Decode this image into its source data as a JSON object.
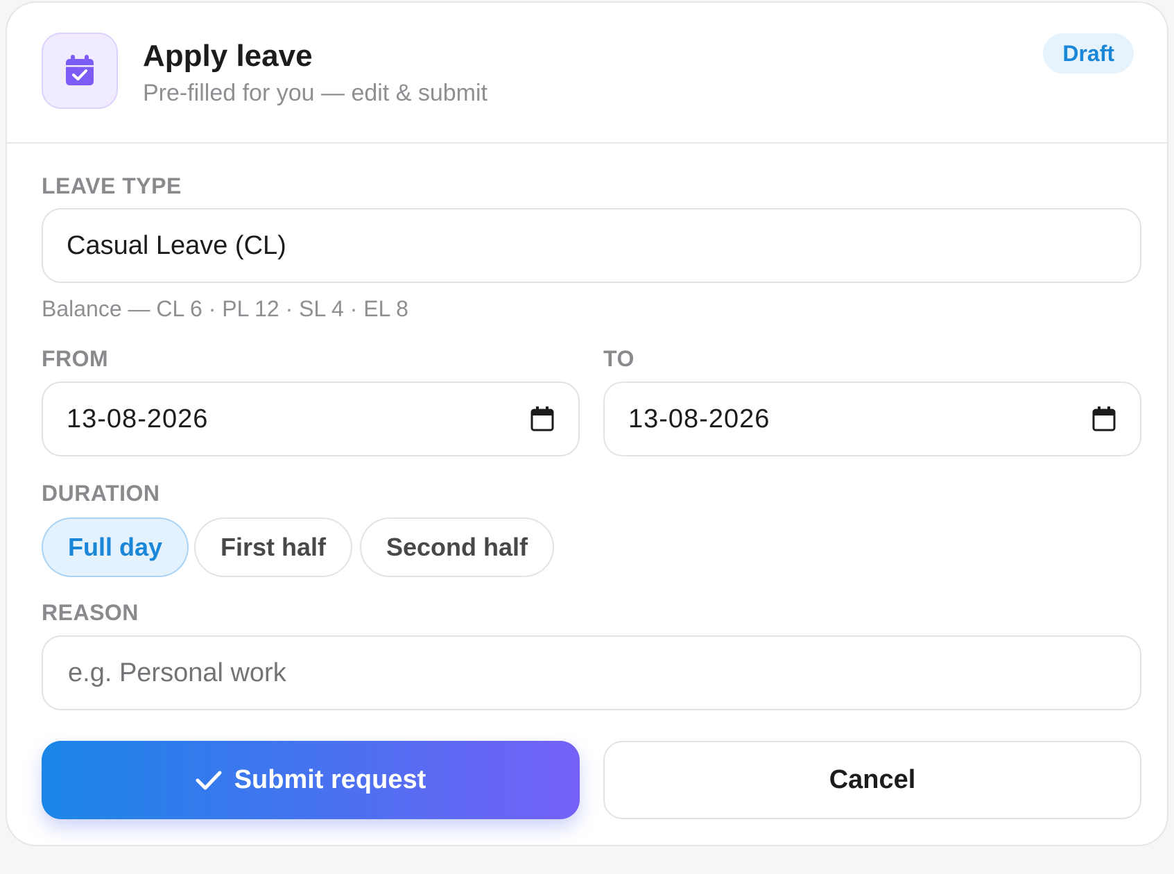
{
  "header": {
    "title": "Apply leave",
    "subtitle": "Pre-filled for you — edit & submit",
    "status_badge": "Draft",
    "icon": "calendar-check-icon"
  },
  "form": {
    "leave_type": {
      "label": "LEAVE TYPE",
      "value": "Casual Leave (CL)",
      "balance_hint": "Balance — CL 6 · PL 12 · SL 4 · EL 8"
    },
    "from": {
      "label": "FROM",
      "value": "13-08-2026",
      "icon": "calendar-icon"
    },
    "to": {
      "label": "TO",
      "value": "13-08-2026",
      "icon": "calendar-icon"
    },
    "duration": {
      "label": "DURATION",
      "options": [
        "Full day",
        "First half",
        "Second half"
      ],
      "selected": "Full day"
    },
    "reason": {
      "label": "REASON",
      "value": "",
      "placeholder": "e.g. Personal work"
    }
  },
  "actions": {
    "submit_label": "Submit request",
    "submit_icon": "check-icon",
    "cancel_label": "Cancel"
  },
  "colors": {
    "accent": "#1a86d8",
    "icon_purple": "#7c5cf5",
    "gradient_start": "#1a86e8",
    "gradient_end": "#7561f6"
  }
}
